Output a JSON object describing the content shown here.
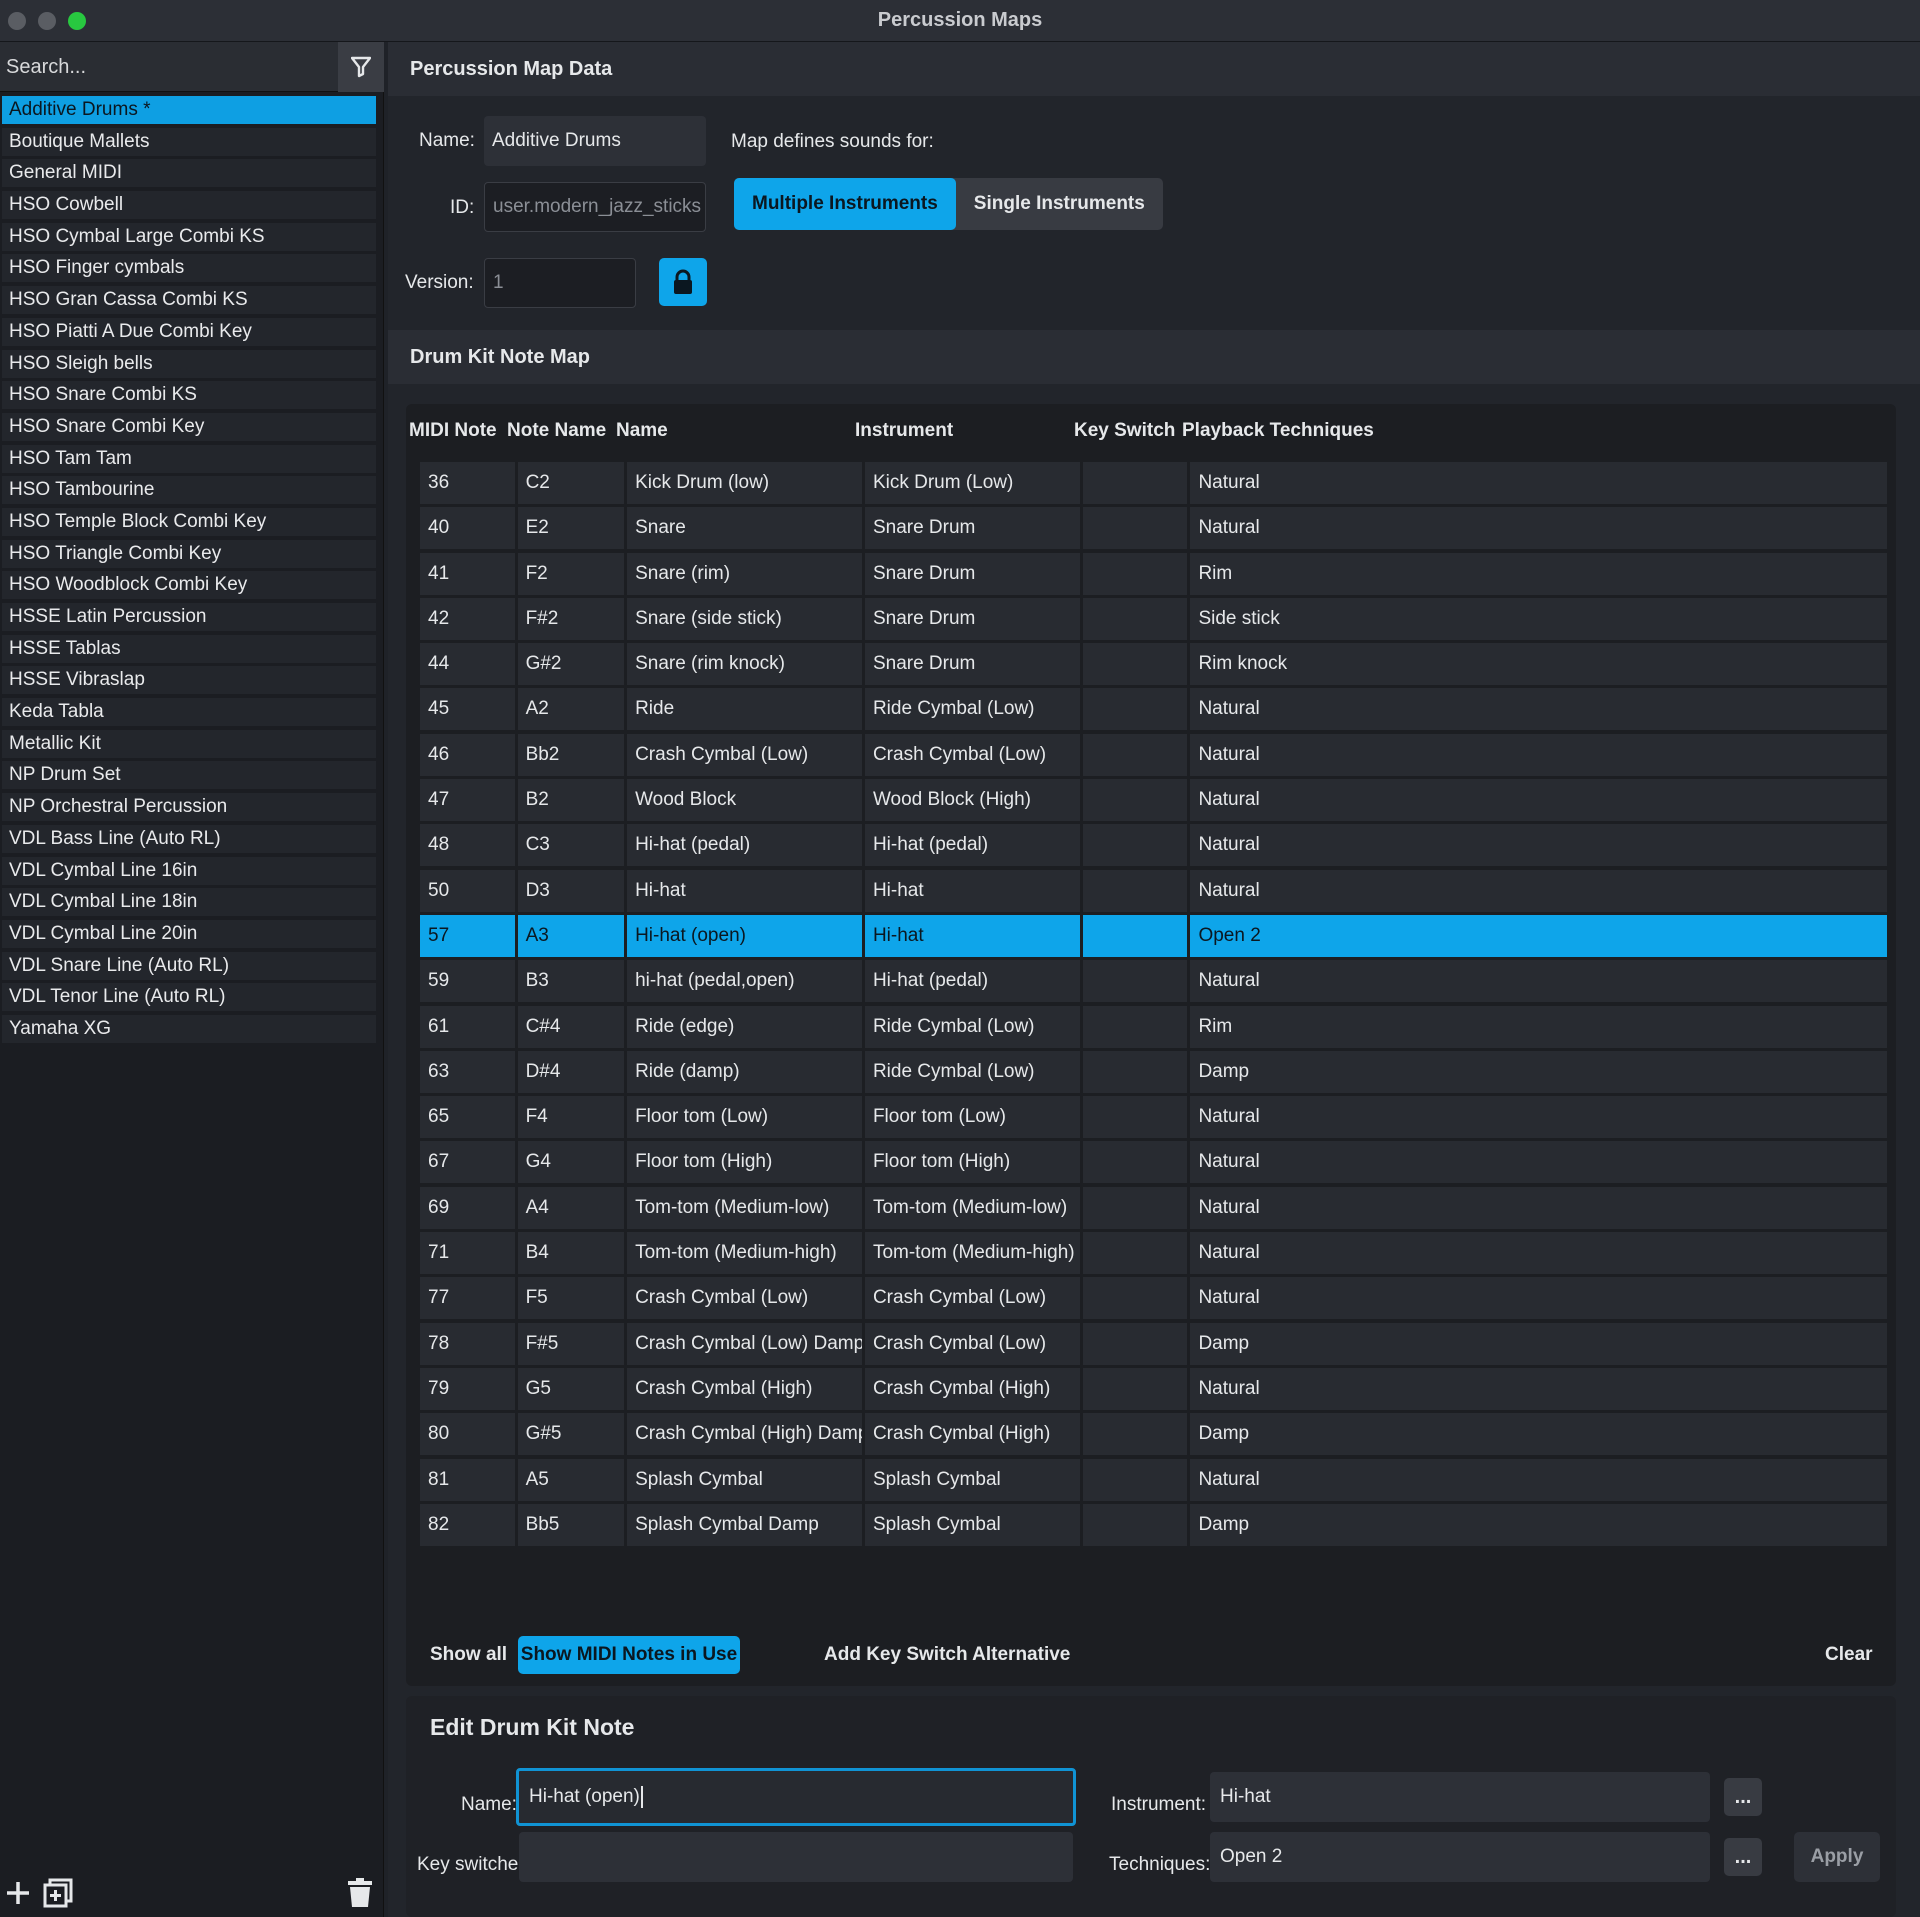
{
  "window": {
    "title": "Percussion Maps"
  },
  "sidebar": {
    "search_placeholder": "Search...",
    "items": [
      "Additive Drums *",
      "Boutique Mallets",
      "General MIDI",
      "HSO Cowbell",
      "HSO Cymbal Large Combi KS",
      "HSO Finger cymbals",
      "HSO Gran Cassa Combi KS",
      "HSO Piatti A Due Combi Key",
      "HSO Sleigh bells",
      "HSO Snare Combi KS",
      "HSO Snare Combi Key",
      "HSO Tam Tam",
      "HSO Tambourine",
      "HSO Temple Block Combi Key",
      "HSO Triangle Combi Key",
      "HSO Woodblock Combi Key",
      "HSSE Latin Percussion",
      "HSSE Tablas",
      "HSSE Vibraslap",
      "Keda Tabla",
      "Metallic Kit",
      "NP Drum Set",
      "NP Orchestral Percussion",
      "VDL Bass Line (Auto RL)",
      "VDL Cymbal Line 16in",
      "VDL Cymbal Line 18in",
      "VDL Cymbal Line 20in",
      "VDL Snare Line (Auto RL)",
      "VDL Tenor Line (Auto RL)",
      "Yamaha XG"
    ],
    "selected_index": 0
  },
  "map_data": {
    "header": "Percussion Map Data",
    "name_label": "Name:",
    "name_value": "Additive Drums",
    "id_label": "ID:",
    "id_value": "user.modern_jazz_sticks",
    "version_label": "Version:",
    "version_value": "1",
    "defines_label": "Map defines sounds for:",
    "multiple_label": "Multiple Instruments",
    "single_label": "Single Instruments"
  },
  "note_map": {
    "header": "Drum Kit Note Map",
    "columns": [
      "MIDI Note",
      "Note Name",
      "Name",
      "Instrument",
      "Key Switch",
      "Playback Techniques"
    ],
    "rows": [
      [
        "36",
        "C2",
        "Kick Drum (low)",
        "Kick Drum (Low)",
        "",
        "Natural"
      ],
      [
        "40",
        "E2",
        "Snare",
        "Snare Drum",
        "",
        "Natural"
      ],
      [
        "41",
        "F2",
        "Snare (rim)",
        "Snare Drum",
        "",
        "Rim"
      ],
      [
        "42",
        "F#2",
        "Snare (side stick)",
        "Snare Drum",
        "",
        "Side stick"
      ],
      [
        "44",
        "G#2",
        "Snare (rim knock)",
        "Snare Drum",
        "",
        "Rim knock"
      ],
      [
        "45",
        "A2",
        "Ride",
        "Ride Cymbal (Low)",
        "",
        "Natural"
      ],
      [
        "46",
        "Bb2",
        "Crash Cymbal (Low)",
        "Crash Cymbal (Low)",
        "",
        "Natural"
      ],
      [
        "47",
        "B2",
        "Wood Block",
        "Wood Block (High)",
        "",
        "Natural"
      ],
      [
        "48",
        "C3",
        "Hi-hat (pedal)",
        "Hi-hat (pedal)",
        "",
        "Natural"
      ],
      [
        "50",
        "D3",
        "Hi-hat",
        "Hi-hat",
        "",
        "Natural"
      ],
      [
        "57",
        "A3",
        "Hi-hat (open)",
        "Hi-hat",
        "",
        "Open 2"
      ],
      [
        "59",
        "B3",
        "hi-hat (pedal,open)",
        "Hi-hat (pedal)",
        "",
        "Natural"
      ],
      [
        "61",
        "C#4",
        "Ride (edge)",
        "Ride Cymbal (Low)",
        "",
        "Rim"
      ],
      [
        "63",
        "D#4",
        "Ride (damp)",
        "Ride Cymbal (Low)",
        "",
        "Damp"
      ],
      [
        "65",
        "F4",
        "Floor tom (Low)",
        "Floor tom (Low)",
        "",
        "Natural"
      ],
      [
        "67",
        "G4",
        "Floor tom (High)",
        "Floor tom (High)",
        "",
        "Natural"
      ],
      [
        "69",
        "A4",
        "Tom-tom (Medium-low)",
        "Tom-tom (Medium-low)",
        "",
        "Natural"
      ],
      [
        "71",
        "B4",
        "Tom-tom (Medium-high)",
        "Tom-tom (Medium-high)",
        "",
        "Natural"
      ],
      [
        "77",
        "F5",
        "Crash Cymbal (Low)",
        "Crash Cymbal (Low)",
        "",
        "Natural"
      ],
      [
        "78",
        "F#5",
        "Crash Cymbal (Low) Damp",
        "Crash Cymbal (Low)",
        "",
        "Damp"
      ],
      [
        "79",
        "G5",
        "Crash Cymbal (High)",
        "Crash Cymbal (High)",
        "",
        "Natural"
      ],
      [
        "80",
        "G#5",
        "Crash Cymbal (High) Damp",
        "Crash Cymbal (High)",
        "",
        "Damp"
      ],
      [
        "81",
        "A5",
        "Splash Cymbal",
        "Splash Cymbal",
        "",
        "Natural"
      ],
      [
        "82",
        "Bb5",
        "Splash Cymbal Damp",
        "Splash Cymbal",
        "",
        "Damp"
      ]
    ],
    "selected_row": 10,
    "show_all_label": "Show all",
    "show_in_use_label": "Show MIDI Notes in Use",
    "add_key_switch_label": "Add Key Switch Alternative",
    "clear_label": "Clear"
  },
  "edit": {
    "title": "Edit Drum Kit Note",
    "name_label": "Name:",
    "name_value": "Hi-hat (open)",
    "instrument_label": "Instrument:",
    "instrument_value": "Hi-hat",
    "keyswitch_label": "Key switches:",
    "keyswitch_value": "",
    "techniques_label": "Techniques:",
    "techniques_value": "Open 2",
    "dots_label": "...",
    "apply_label": "Apply"
  },
  "colors": {
    "accent": "#0ea5ea",
    "background": "#22252b",
    "panel": "#2a2d34"
  }
}
